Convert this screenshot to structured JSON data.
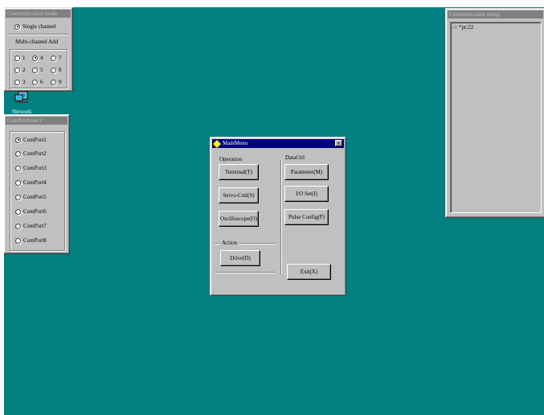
{
  "comm_mode": {
    "title": "Communication mode",
    "single_channel": "Single channel",
    "multi_channel_label": "Multi-channel Add",
    "options": [
      "1",
      "4",
      "7",
      "2",
      "5",
      "8",
      "3",
      "6",
      "9"
    ]
  },
  "network_icon": {
    "label": "Network"
  },
  "com_port_select": {
    "title": "ComPortSelect",
    "ports": [
      "ComPort1",
      "ComPort2",
      "ComPort3",
      "ComPort4",
      "ComPort5",
      "ComPort6",
      "ComPort7",
      "ComPort8"
    ]
  },
  "main_menu": {
    "title": "MainMenu",
    "operation_label": "Operation",
    "datactl_label": "DataCtrl",
    "action_label": "Action",
    "terminal": "Terminal(T)",
    "servo_cntl": "Servo-Cntl(S)",
    "oscilloscope": "Oscilloscope(O)",
    "drive": "Drive(D)",
    "parameter": "Parameter(M)",
    "io_set": "I/O Set(I)",
    "pulse_config": "Pulse Config(P)",
    "exit": "Exit(X)"
  },
  "comm_string": {
    "title": "Communication string",
    "content": "-> *pr:22"
  },
  "colors": {
    "desktop": "#008080",
    "window_face": "#c0c0c0",
    "active_title": "#000080",
    "inactive_title": "#808080"
  }
}
